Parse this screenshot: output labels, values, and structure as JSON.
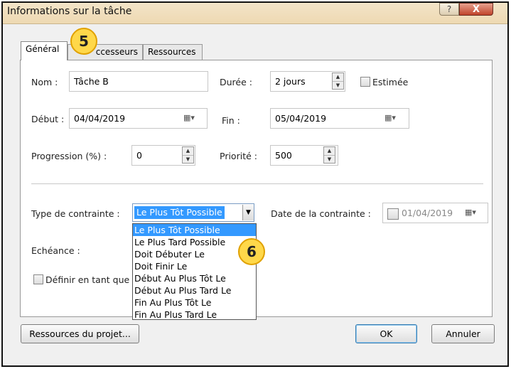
{
  "window": {
    "title": "Informations sur la tâche",
    "help": "?",
    "close": "X"
  },
  "tabs": [
    {
      "label": "Général"
    },
    {
      "label": "ccesseurs"
    },
    {
      "label": "Ressources"
    }
  ],
  "badges": {
    "tab": "5",
    "list": "6"
  },
  "form": {
    "name_label": "Nom :",
    "name_value": "Tâche B",
    "duration_label": "Durée :",
    "duration_value": "2 jours",
    "estimated_label": "Estimée",
    "start_label": "Début :",
    "start_value": "04/04/2019",
    "end_label": "Fin :",
    "end_value": "05/04/2019",
    "progress_label": "Progression (%) :",
    "progress_value": "0",
    "priority_label": "Priorité :",
    "priority_value": "500",
    "constraint_type_label": "Type de contrainte :",
    "constraint_type_value": "Le Plus Tôt Possible",
    "constraint_date_label": "Date de la contrainte :",
    "constraint_date_value": "01/04/2019",
    "deadline_label": "Echéance :",
    "define_label": "Définir en tant que"
  },
  "constraint_options": [
    "Le Plus Tôt Possible",
    "Le Plus Tard Possible",
    "Doit Débuter Le",
    "Doit Finir Le",
    "Début Au Plus Tôt Le",
    "Début Au Plus Tard Le",
    "Fin Au Plus Tôt Le",
    "Fin Au Plus Tard Le"
  ],
  "buttons": {
    "resources": "Ressources du projet...",
    "ok": "OK",
    "cancel": "Annuler"
  }
}
